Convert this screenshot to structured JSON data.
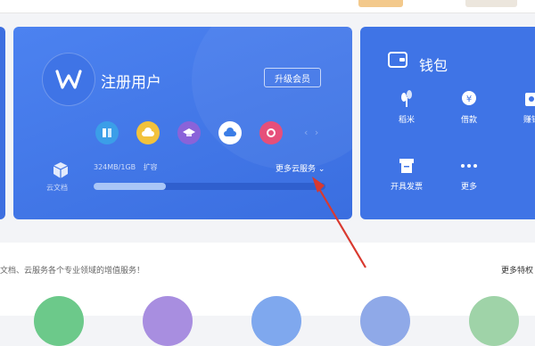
{
  "account": {
    "title": "注册用户",
    "upgrade_label": "升级会员",
    "cloud_doc_label": "云文档",
    "storage_text": "324MB/1GB",
    "storage_extra": "扩容",
    "storage_used_fraction": 0.31,
    "more_services_label": "更多云服务",
    "services": [
      "service-1-icon",
      "service-2-icon",
      "service-3-icon",
      "service-4-icon",
      "service-5-icon"
    ]
  },
  "wallet": {
    "title": "钱包",
    "items": [
      {
        "label": "稻米",
        "icon": "rice-icon"
      },
      {
        "label": "借款",
        "icon": "loan-icon"
      },
      {
        "label": "赚钱",
        "icon": "earn-icon"
      },
      {
        "label": "开具发票",
        "icon": "invoice-icon"
      },
      {
        "label": "更多",
        "icon": "more-icon"
      }
    ]
  },
  "bottom": {
    "promo_text": "文档、云服务各个专业领域的增值服务！",
    "more_features_label": "更多特权"
  },
  "colors": {
    "card_blue": "#3f74e6",
    "annotation_red": "#d9392f"
  }
}
